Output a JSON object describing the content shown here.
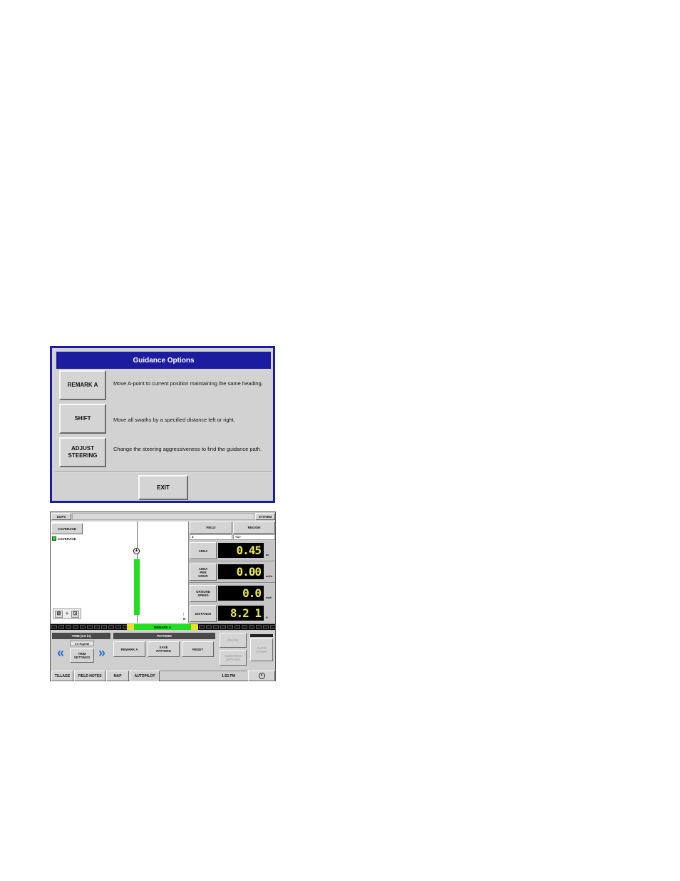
{
  "dialog": {
    "title": "Guidance Options",
    "options": [
      {
        "label": "REMARK A",
        "description": "Move A-point to current position maintaining the same heading."
      },
      {
        "label": "SHIFT",
        "description": "Move all swaths by a specified distance left or right."
      },
      {
        "label": "ADJUST\nSTEERING",
        "description": "Change the steering aggressiveness to find the guidance path."
      }
    ],
    "exit_label": "EXIT"
  },
  "screen": {
    "header": {
      "left_label": "DGPS",
      "right_label": "SYSTEM"
    },
    "map": {
      "coverage_button": "COVERAGE",
      "legend_label": "COVERAGE",
      "legend_color": "#22dd22",
      "swath_color": "#22dd22",
      "north_label": "N"
    },
    "field_tabs": {
      "field": "FIELD",
      "region": "REGION",
      "field_value": "3",
      "region_value": "<1>"
    },
    "meters": [
      {
        "label": "AREA",
        "value": "0.45",
        "unit": "ac"
      },
      {
        "label": "AREA\nPER\nHOUR",
        "value": "0.00",
        "unit": "ac/hr"
      },
      {
        "label": "GROUND\nSPEED",
        "value": "0.0",
        "unit": "mph"
      },
      {
        "label": "DISTANCE",
        "value": "8.2 1",
        "unit": "ft"
      }
    ],
    "guidance_bar": {
      "label": "REMARK A",
      "on_color": "#22dd22",
      "edge_color": "#e8e020"
    },
    "trim": {
      "title": "TRIM (0.0 in)",
      "readout": "0.0 RightM",
      "settings_label": "TRIM\nSETTINGS"
    },
    "pattern": {
      "title": "PATTERN",
      "remark_a": "REMARK A",
      "save_pattern": "SAVE\nPATTERN",
      "reset": "RESET"
    },
    "right_buttons": {
      "pause": "PAUSE",
      "guidance_options": "GUIDANCE\nOPTIONS",
      "auto_steer": "AUTO\nSTEER"
    },
    "tabs": [
      "TILLAGE",
      "FIELD NOTES",
      "MAP",
      "AUTOPILOT"
    ],
    "time": "1:52 PM",
    "colors": {
      "dialog_title": "#1c1ca0",
      "panel": "#cfcfcf",
      "lcd_digits": "#e8e85a"
    }
  }
}
